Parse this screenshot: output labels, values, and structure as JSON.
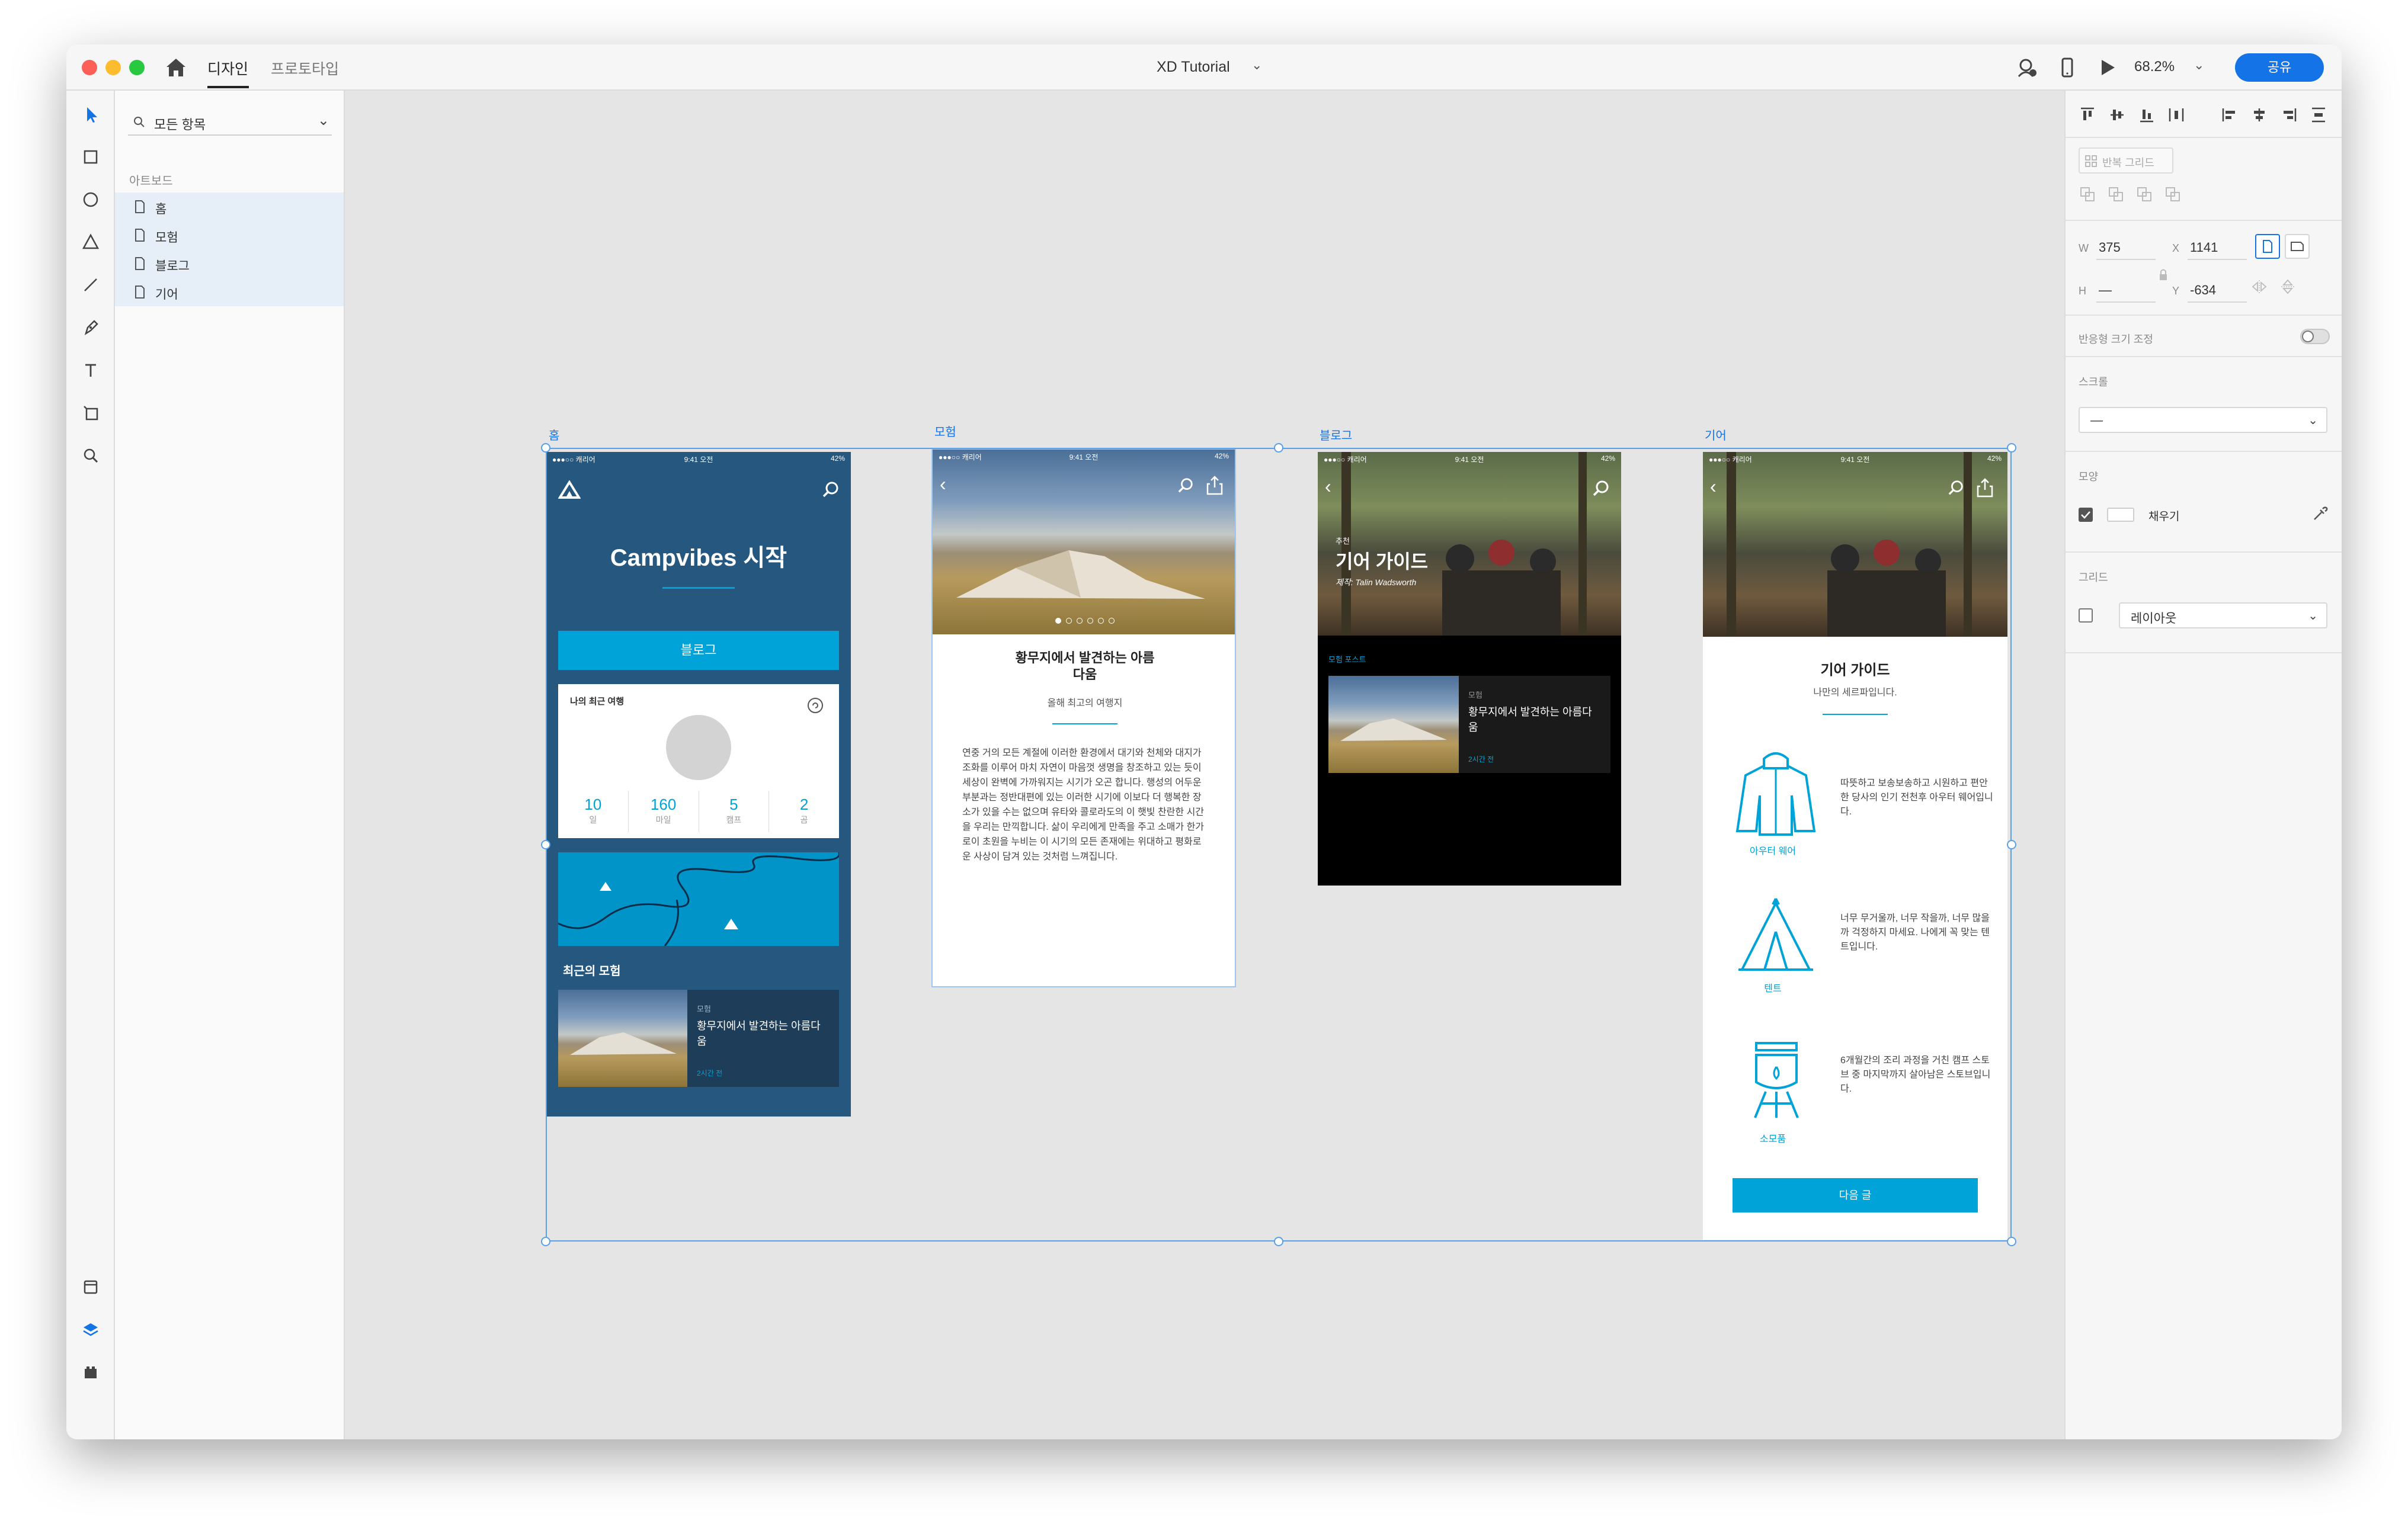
{
  "topbar": {
    "tabs": [
      "디자인",
      "프로토타입"
    ],
    "doc_title": "XD Tutorial",
    "zoom": "68.2%",
    "share_label": "공유"
  },
  "layers_panel": {
    "search_placeholder": "모든 항목",
    "heading": "아트보드",
    "items": [
      {
        "label": "홈"
      },
      {
        "label": "모험"
      },
      {
        "label": "블로그"
      },
      {
        "label": "기어"
      }
    ]
  },
  "props": {
    "repeat_grid": "반복 그리드",
    "w_label": "W",
    "w": "375",
    "x_label": "X",
    "x": "1141",
    "h_label": "H",
    "h": "—",
    "y_label": "Y",
    "y": "-634",
    "responsive_resize": "반응형 크기 조정",
    "scroll_label": "스크롤",
    "scroll_value": "—",
    "appearance_label": "모양",
    "fill_label": "채우기",
    "grid_label": "그리드",
    "grid_value": "레이아웃"
  },
  "artboards": {
    "home": {
      "label": "홈",
      "status_left": "●●●○○ 캐리어 ",
      "status_time": "9:41 오전",
      "status_right": "42%",
      "title": "Campvibes 시작",
      "blog_button": "블로그",
      "card_title": "나의 최근 여행",
      "stats": [
        {
          "value": "10",
          "unit": "일"
        },
        {
          "value": "160",
          "unit": "마일"
        },
        {
          "value": "5",
          "unit": "캠프"
        },
        {
          "value": "2",
          "unit": "곰"
        }
      ],
      "recent_heading": "최근의 모험",
      "recent_category": "모험",
      "recent_title": "황무지에서 발견하는 아름다움",
      "recent_time": "2시간 전"
    },
    "adventure": {
      "label": "모험",
      "status_left": "●●●○○ 캐리어 ",
      "status_time": "9:41 오전",
      "status_right": "42%",
      "title": "황무지에서 발견하는 아름다움",
      "subtitle": "올해 최고의 여행지",
      "body": "연중 거의 모든 계절에 이러한 환경에서 대기와 천체와 대지가 조화를 이루어 마치 자연이 마음껏 생명을 창조하고 있는 듯이 세상이 완벽에 가까워지는 시기가 오곤 합니다. 행성의 어두운 부분과는 정반대편에 있는 이러한 시기에 이보다 더 행복한 장소가 있을 수는 없으며 유타와 콜로라도의 이 햇빛 찬란한 시간을 우리는 만끽합니다. 삶이 우리에게 만족을 주고 소매가 한가로이 초원을 누비는 이 시기의 모든 존재에는 위대하고 평화로운 사상이 담겨 있는 것처럼 느껴집니다."
    },
    "blog": {
      "label": "블로그",
      "status_left": "●●●○○ 캐리어 ",
      "status_time": "9:41 오전",
      "status_right": "42%",
      "kicker": "추천",
      "title": "기어 가이드",
      "byline": "제작: Talin Wadsworth",
      "section": "모험 포스트",
      "post_category": "모험",
      "post_title": "황무지에서 발견하는 아름다움",
      "post_time": "2시간 전"
    },
    "gear": {
      "label": "기어",
      "status_left": "●●●○○ 캐리어 ",
      "status_time": "9:41 오전",
      "status_right": "42%",
      "title": "기어 가이드",
      "subtitle": "나만의 세르파입니다.",
      "items": [
        {
          "name": "아우터 웨어",
          "desc": "따뜻하고 보송보송하고 시원하고 편안한 당사의 인기 전천후 아우터 웨어입니다."
        },
        {
          "name": "텐트",
          "desc": "너무 무거울까, 너무 작을까, 너무 많을까 걱정하지 마세요. 나에게 꼭 맞는 텐트입니다."
        },
        {
          "name": "소모품",
          "desc": "6개월간의 조리 과정을 거친 캠프 스토브 중 마지막까지 살아남은 스토브입니다."
        }
      ],
      "next_button": "다음 글"
    }
  },
  "colors": {
    "accent": "#1473e6",
    "brand_blue": "#00a3d8",
    "home_bg": "#25577f",
    "selection": "#5aa0e6"
  }
}
